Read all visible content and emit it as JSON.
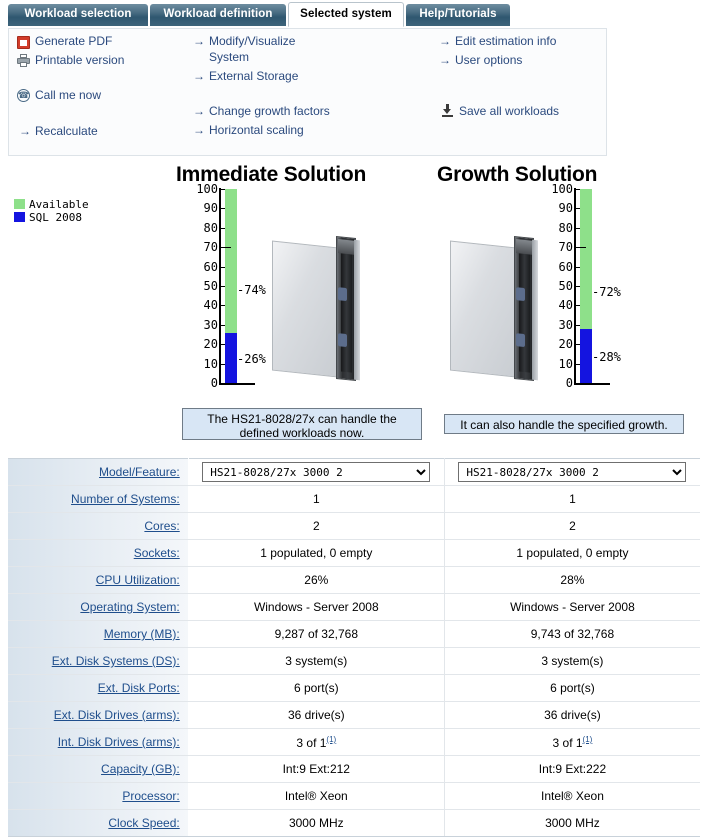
{
  "tabs": [
    {
      "label": "Workload selection",
      "active": false
    },
    {
      "label": "Workload definition",
      "active": false
    },
    {
      "label": "Selected system",
      "active": true
    },
    {
      "label": "Help/Tutorials",
      "active": false
    }
  ],
  "actions": {
    "generate_pdf": "Generate PDF",
    "printable_version": "Printable version",
    "call_me_now": "Call me now",
    "recalculate": "Recalculate",
    "modify_visualize_system_line1": "Modify/Visualize",
    "modify_visualize_system_line2": "System",
    "external_storage": "External Storage",
    "change_growth_factors": "Change growth factors",
    "horizontal_scaling": "Horizontal scaling",
    "edit_estimation_info": "Edit estimation info",
    "user_options": "User options",
    "save_all_workloads": "Save all workloads",
    "arrow": "→"
  },
  "legend": [
    {
      "label": "Available",
      "color": "#8ee08a"
    },
    {
      "label": "SQL 2008",
      "color": "#1414e0"
    }
  ],
  "charts": {
    "immediate": {
      "title": "Immediate Solution",
      "message": "The HS21-8028/27x can handle the defined workloads now."
    },
    "growth": {
      "title": "Growth Solution",
      "message": "It can also handle the specified growth."
    }
  },
  "chart_data": [
    {
      "type": "bar",
      "title": "Immediate Solution",
      "categories": [
        "Utilization"
      ],
      "series": [
        {
          "name": "SQL 2008",
          "values": [
            26
          ],
          "color": "#1414e0",
          "label": "-26%"
        },
        {
          "name": "Available",
          "values": [
            74
          ],
          "color": "#8ee08a",
          "label": "-74%"
        }
      ],
      "stacked": true,
      "ylabel": "",
      "xlabel": "",
      "ylim": [
        0,
        100
      ],
      "yticks": [
        0,
        10,
        20,
        30,
        40,
        50,
        60,
        70,
        80,
        90,
        100
      ],
      "ytick_labels": [
        "0",
        "10",
        "20",
        "30",
        "40",
        "50",
        "60",
        "70",
        "80",
        "90",
        "100"
      ],
      "grid": false,
      "legend_position": "left"
    },
    {
      "type": "bar",
      "title": "Growth Solution",
      "categories": [
        "Utilization"
      ],
      "series": [
        {
          "name": "SQL 2008",
          "values": [
            28
          ],
          "color": "#1414e0",
          "label": "-28%"
        },
        {
          "name": "Available",
          "values": [
            72
          ],
          "color": "#8ee08a",
          "label": "-72%"
        }
      ],
      "stacked": true,
      "ylabel": "",
      "xlabel": "",
      "ylim": [
        0,
        100
      ],
      "yticks": [
        0,
        10,
        20,
        30,
        40,
        50,
        60,
        70,
        80,
        90,
        100
      ],
      "ytick_labels": [
        "0",
        "10",
        "20",
        "30",
        "40",
        "50",
        "60",
        "70",
        "80",
        "90",
        "100"
      ],
      "grid": false,
      "legend_position": "left"
    }
  ],
  "spec_table": {
    "rows": [
      {
        "label": "Model/Feature:",
        "type": "select",
        "immediate": "HS21-8028/27x    3000  2",
        "growth": "HS21-8028/27x    3000  2"
      },
      {
        "label": "Number of Systems:",
        "type": "text",
        "immediate": "1",
        "growth": "1"
      },
      {
        "label": "Cores:",
        "type": "text",
        "immediate": "2",
        "growth": "2"
      },
      {
        "label": "Sockets:",
        "type": "text",
        "immediate": "1 populated, 0 empty",
        "growth": "1 populated, 0 empty"
      },
      {
        "label": "CPU Utilization:",
        "type": "text",
        "immediate": "26%",
        "growth": "28%"
      },
      {
        "label": "Operating System:",
        "type": "text",
        "immediate": "Windows - Server 2008",
        "growth": "Windows - Server 2008"
      },
      {
        "label": "Memory (MB):",
        "type": "text",
        "immediate": "9,287 of 32,768",
        "growth": "9,743 of 32,768"
      },
      {
        "label": "Ext. Disk Systems (DS):",
        "type": "text",
        "immediate": "3 system(s)",
        "growth": "3 system(s)"
      },
      {
        "label": "Ext. Disk Ports:",
        "type": "text",
        "immediate": "6 port(s)",
        "growth": "6 port(s)"
      },
      {
        "label": "Ext. Disk Drives (arms):",
        "type": "text",
        "immediate": "36 drive(s)",
        "growth": "36 drive(s)"
      },
      {
        "label": "Int. Disk Drives (arms):",
        "type": "footnote",
        "immediate": "3 of 1",
        "growth": "3 of 1",
        "footnote": "(1)"
      },
      {
        "label": "Capacity (GB):",
        "type": "text",
        "immediate": "Int:9  Ext:212",
        "growth": "Int:9  Ext:222"
      },
      {
        "label": "Processor:",
        "type": "text",
        "immediate": "Intel® Xeon",
        "growth": "Intel® Xeon"
      },
      {
        "label": "Clock Speed:",
        "type": "text",
        "immediate": "3000 MHz",
        "growth": "3000 MHz"
      }
    ]
  }
}
